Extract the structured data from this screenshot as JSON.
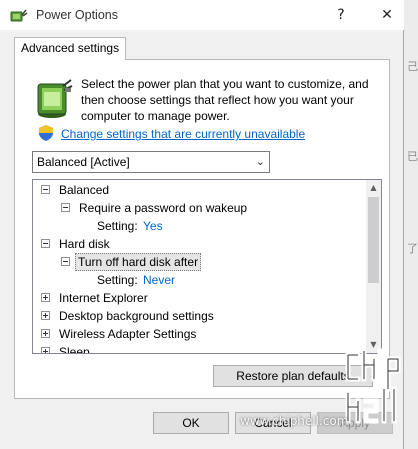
{
  "window": {
    "title": "Power Options",
    "help_button": "?",
    "close_button": "✕"
  },
  "tab": {
    "label": "Advanced settings"
  },
  "intro": {
    "text": "Select the power plan that you want to customize, and then choose settings that reflect how you want your computer to manage power.",
    "link": "Change settings that are currently unavailable"
  },
  "plan_dropdown": {
    "value": "Balanced [Active]"
  },
  "tree": {
    "items": [
      {
        "label": "Balanced",
        "expander": "minus"
      },
      {
        "label": "Require a password on wakeup",
        "expander": "minus"
      },
      {
        "setting_label": "Setting:",
        "value": "Yes"
      },
      {
        "label": "Hard disk",
        "expander": "minus"
      },
      {
        "label": "Turn off hard disk after",
        "expander": "minus",
        "selected": true
      },
      {
        "setting_label": "Setting:",
        "value": "Never"
      },
      {
        "label": "Internet Explorer",
        "expander": "plus"
      },
      {
        "label": "Desktop background settings",
        "expander": "plus"
      },
      {
        "label": "Wireless Adapter Settings",
        "expander": "plus"
      },
      {
        "label": "Sleep",
        "expander": "plus"
      }
    ]
  },
  "buttons": {
    "restore": "Restore plan defaults",
    "ok": "OK",
    "cancel": "Cancel",
    "apply": "Apply"
  },
  "watermark": {
    "text": "www.chiphell.com"
  },
  "colors": {
    "link": "#0066cc",
    "value": "#0066cc",
    "window_bg": "#f0f0f0"
  }
}
